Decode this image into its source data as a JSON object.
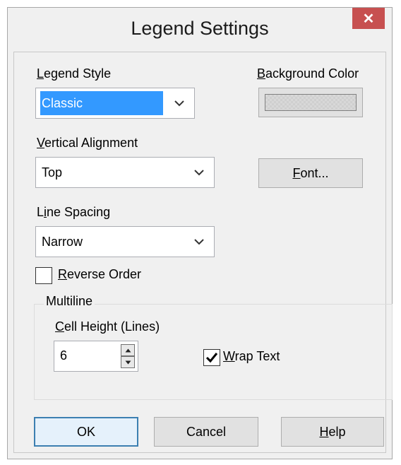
{
  "window": {
    "title": "Legend Settings",
    "close_glyph": "✕"
  },
  "legend_style": {
    "label_acc": "L",
    "label_rest": "egend Style",
    "value": "Classic"
  },
  "background_color": {
    "label_acc": "B",
    "label_rest": "ackground Color"
  },
  "vertical_alignment": {
    "label_acc": "V",
    "label_rest": "ertical Alignment",
    "value": "Top"
  },
  "font_button": {
    "label_acc": "F",
    "label_rest": "ont..."
  },
  "line_spacing": {
    "label_pre": "L",
    "label_acc": "i",
    "label_rest": "ne Spacing",
    "value": "Narrow"
  },
  "reverse_order": {
    "label_acc": "R",
    "label_rest": "everse Order",
    "checked": false
  },
  "multiline": {
    "group_label": "Multiline",
    "cell_height_label_acc": "C",
    "cell_height_label_rest": "ell Height (Lines)",
    "cell_height_value": "6",
    "wrap_text_acc": "W",
    "wrap_text_rest": "rap Text",
    "wrap_text_checked": true
  },
  "buttons": {
    "ok": "OK",
    "cancel": "Cancel",
    "help_acc": "H",
    "help_rest": "elp"
  },
  "colors": {
    "selection": "#3399ff",
    "close": "#c75050",
    "default_border": "#3c7fb1"
  },
  "icons": [
    "close-icon",
    "chevron-down-icon",
    "spin-up-icon",
    "spin-down-icon",
    "checkmark-icon"
  ]
}
